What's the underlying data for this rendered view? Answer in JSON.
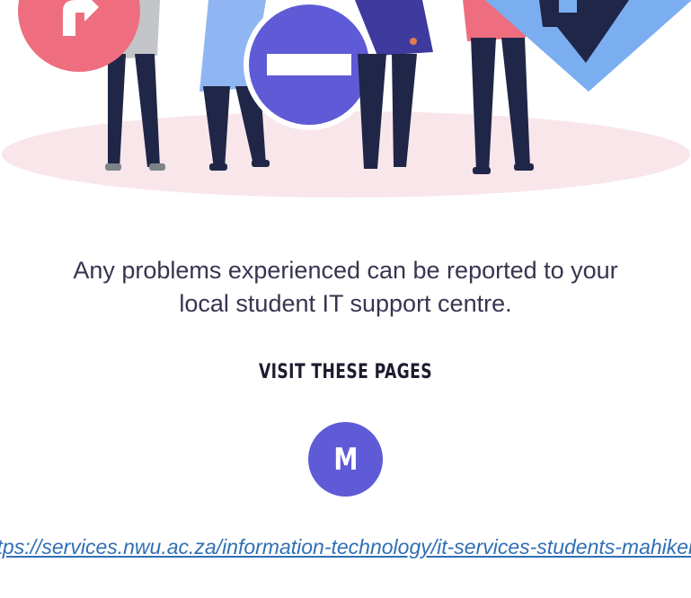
{
  "message": {
    "line1": "Any problems experienced can be reported to your",
    "line2": "local student IT support centre."
  },
  "section": {
    "heading": "VISIT THESE PAGES"
  },
  "avatar": {
    "letter": "M",
    "color": "#5f5bd6"
  },
  "link": {
    "text": "https://services.nwu.ac.za/information-technology/it-services-students-mahikeng",
    "color": "#2f6fb5"
  },
  "illustration": {
    "icons": [
      "turn-right-sign-icon",
      "no-entry-sign-icon",
      "down-arrow-sign-icon"
    ],
    "colors": {
      "floor": "#f8e6ea",
      "sign_red": "#ee6e7f",
      "sign_blue": "#5f5bd6",
      "arrow_sign": "#7aaef0",
      "pants": "#1f2647"
    }
  }
}
